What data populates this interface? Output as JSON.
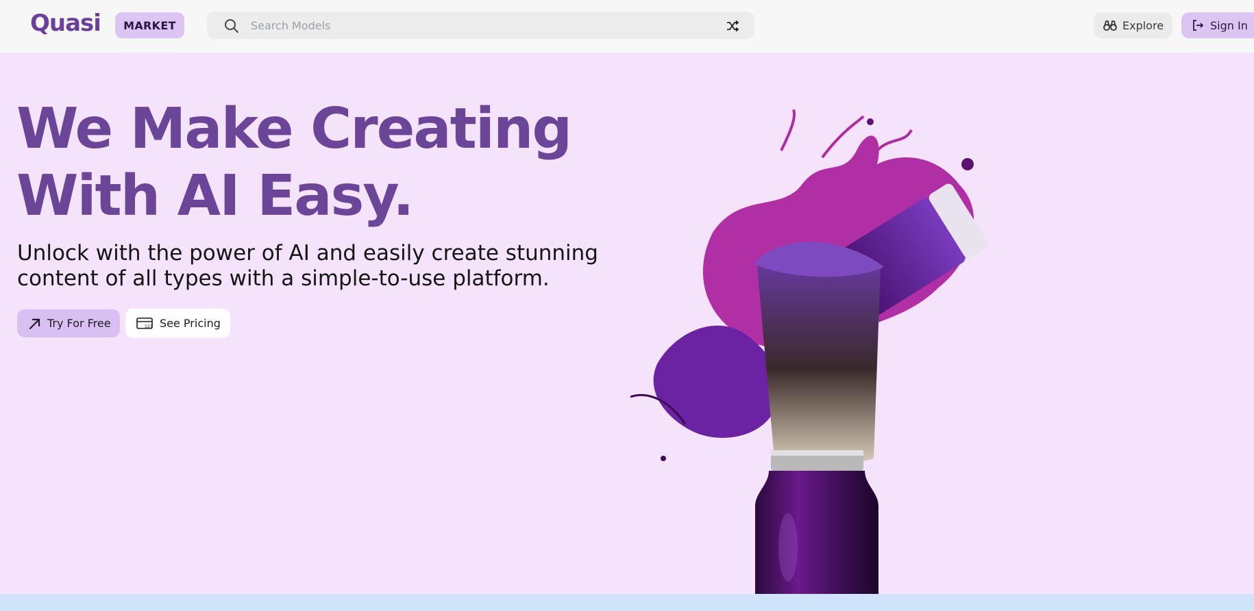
{
  "header": {
    "logo_text": "Quasi",
    "badge_label": "MARKET",
    "search": {
      "placeholder": "Search Models",
      "value": ""
    },
    "explore_label": "Explore",
    "signin_label": "Sign In"
  },
  "hero": {
    "title_line1": "We Make Creating",
    "title_line2": "With AI Easy.",
    "subtitle_line1": "Unlock with the power of AI and easily create stunning",
    "subtitle_line2": "content of all types with a simple-to-use platform.",
    "primary_button": "Try For Free",
    "secondary_button": "See Pricing"
  },
  "icons": {
    "search": "search-icon",
    "shuffle": "shuffle-icon",
    "explore": "binoculars-icon",
    "signin": "sign-in-icon",
    "try": "arrow-up-right-icon",
    "pricing": "price-card-icon"
  },
  "colors": {
    "brand_purple": "#6b4597",
    "accent_lavender": "#dcc4f3",
    "hero_background": "#f4e3fb",
    "header_background": "#f7f7f7",
    "footer_strip": "#cfe3fb"
  }
}
